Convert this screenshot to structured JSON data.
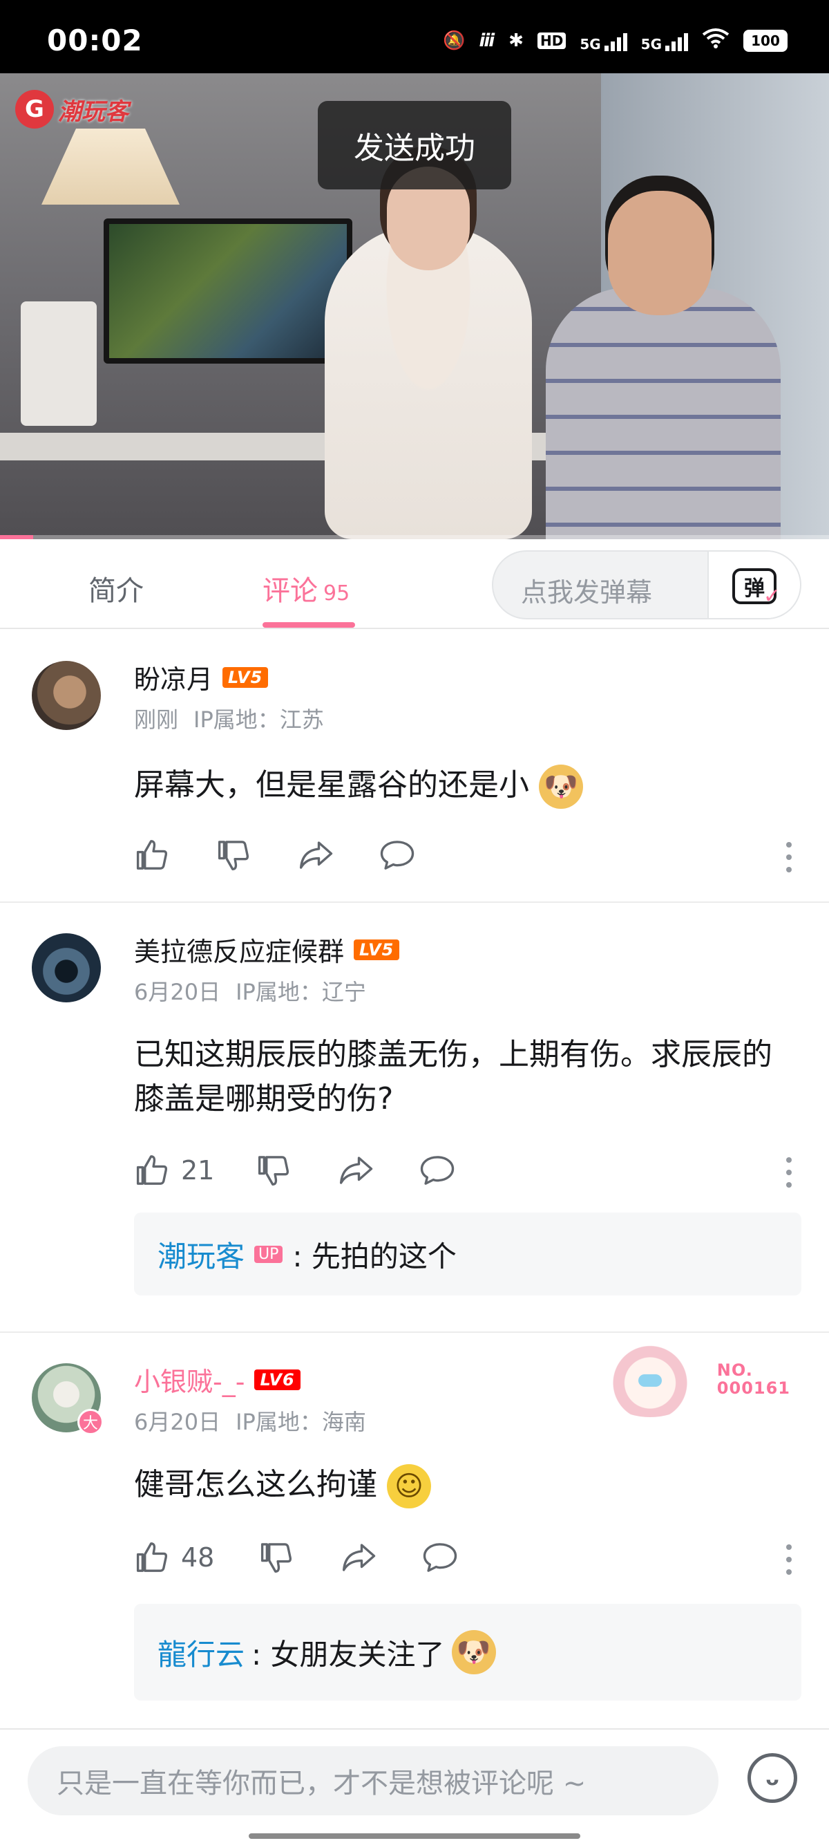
{
  "status_bar": {
    "time": "00:02",
    "battery": "100",
    "network": "5G",
    "hd": "HD"
  },
  "video": {
    "logo_text": "潮玩客",
    "toast": "发送成功",
    "progress_percent": 4
  },
  "tabs": {
    "intro": "简介",
    "comments": "评论",
    "comments_count": "95",
    "danmaku_placeholder": "点我发弹幕",
    "danmaku_icon": "弹"
  },
  "comments": [
    {
      "username": "盼凉月",
      "level": "LV5",
      "time": "刚刚",
      "ip": "IP属地：江苏",
      "content": "屏幕大，但是星露谷的还是小",
      "emoji": "doge-emoji",
      "likes": ""
    },
    {
      "username": "美拉德反应症候群",
      "level": "LV5",
      "time": "6月20日",
      "ip": "IP属地：辽宁",
      "content": "已知这期辰辰的膝盖无伤，上期有伤。求辰辰的膝盖是哪期受的伤?",
      "likes": "21",
      "reply": {
        "user": "潮玩客",
        "tag": "UP",
        "text": ": 先拍的这个"
      }
    },
    {
      "username": "小银贼-_-",
      "level": "LV6",
      "time": "6月20日",
      "ip": "IP属地：海南",
      "content": "健哥怎么这么拘谨",
      "emoji": "grin-emoji",
      "likes": "48",
      "avatar_badge": "大",
      "fan_card_no": "NO.\n000161",
      "reply": {
        "user": "龍行云",
        "text": ": 女朋友关注了",
        "emoji": "doge-emoji"
      }
    }
  ],
  "bottom_bar": {
    "input_placeholder": "只是一直在等你而已，才不是想被评论呢 ~"
  },
  "colors": {
    "accent": "#fb7299",
    "lv5": "#ff6c00",
    "lv6": "#ff0000",
    "link": "#178bcf"
  }
}
